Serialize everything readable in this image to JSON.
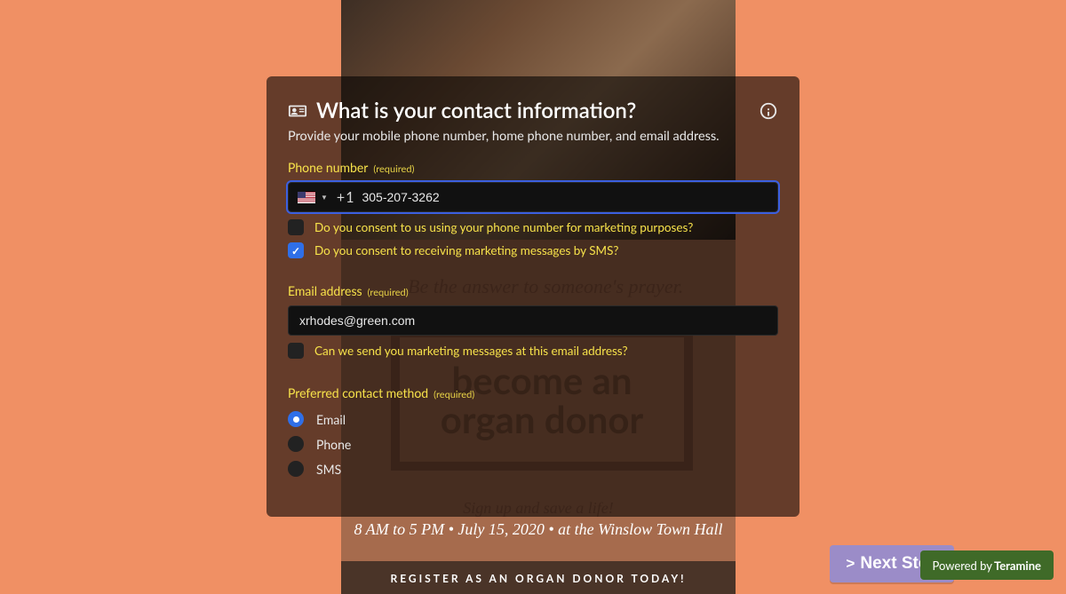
{
  "background": {
    "tagline": "Be the answer to someone's prayer.",
    "box_line1": "become an",
    "box_line2": "organ donor",
    "signup": "Sign up and save a life!",
    "datetime": "8 AM to 5 PM • July 15, 2020 • at the Winslow Town Hall",
    "register_bar": "REGISTER AS AN ORGAN DONOR TODAY!"
  },
  "form": {
    "title": "What is your contact information?",
    "subtitle": "Provide your mobile phone number, home phone number, and email address.",
    "phone": {
      "label": "Phone number",
      "required": "(required)",
      "country_code": "+1",
      "value": "305-207-3262",
      "consent_marketing": "Do you consent to us using your phone number for marketing purposes?",
      "consent_sms": "Do you consent to receiving marketing messages by SMS?",
      "consent_marketing_checked": false,
      "consent_sms_checked": true
    },
    "email": {
      "label": "Email address",
      "required": "(required)",
      "value": "xrhodes@green.com",
      "consent_email": "Can we send you marketing messages at this email address?",
      "consent_email_checked": false
    },
    "contact_method": {
      "label": "Preferred contact method",
      "required": "(required)",
      "options": [
        "Email",
        "Phone",
        "SMS"
      ],
      "selected": "Email"
    }
  },
  "footer": {
    "next": "Next Step",
    "powered_prefix": "Powered by",
    "powered_brand": "Teramine"
  }
}
